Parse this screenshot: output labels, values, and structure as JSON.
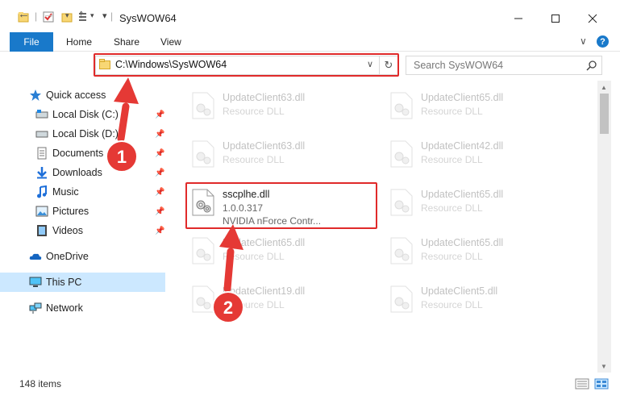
{
  "window": {
    "title": "SysWOW64",
    "minimize_icon": "minimize-icon",
    "maximize_icon": "maximize-icon",
    "close_icon": "close-icon"
  },
  "ribbon": {
    "tabs": [
      "File",
      "Home",
      "Share",
      "View"
    ],
    "help": "?"
  },
  "navigation": {
    "address": "C:\\Windows\\SysWOW64",
    "search_placeholder": "Search SysWOW64"
  },
  "sidebar": {
    "items": [
      {
        "label": "Quick access",
        "icon": "star-icon"
      },
      {
        "label": "Local Disk (C:)",
        "icon": "drive-icon",
        "pinned": true
      },
      {
        "label": "Local Disk (D:)",
        "icon": "drive-icon",
        "pinned": true
      },
      {
        "label": "Documents",
        "icon": "documents-icon",
        "pinned": true
      },
      {
        "label": "Downloads",
        "icon": "download-icon",
        "pinned": true
      },
      {
        "label": "Music",
        "icon": "music-icon",
        "pinned": true
      },
      {
        "label": "Pictures",
        "icon": "pictures-icon",
        "pinned": true
      },
      {
        "label": "Videos",
        "icon": "videos-icon",
        "pinned": true
      },
      {
        "label": "OneDrive",
        "icon": "onedrive-icon"
      },
      {
        "label": "This PC",
        "icon": "computer-icon",
        "selected": true
      },
      {
        "label": "Network",
        "icon": "network-icon"
      }
    ]
  },
  "files": [
    {
      "name": "UpdateClient63.dll",
      "type": "Resource DLL"
    },
    {
      "name": "UpdateClient65.dll",
      "type": "Resource DLL"
    },
    {
      "name": "UpdateClient63.dll",
      "type": "Resource DLL"
    },
    {
      "name": "UpdateClient42.dll",
      "type": "Resource DLL"
    },
    {
      "name": "sscplhe.dll",
      "version": "1.0.0.317",
      "description": "NVIDIA nForce Contr..."
    },
    {
      "name": "UpdateClient65.dll",
      "type": "Resource DLL"
    },
    {
      "name": "UpdateClient65.dll",
      "type": "Resource DLL"
    },
    {
      "name": "UpdateClient65.dll",
      "type": "Resource DLL"
    },
    {
      "name": "UpdateClient19.dll",
      "type": "Resource DLL"
    },
    {
      "name": "UpdateClient5.dll",
      "type": "Resource DLL"
    }
  ],
  "status": {
    "item_count": "148 items"
  },
  "annotations": {
    "step1": "1",
    "step2": "2",
    "highlight_color": "#e02a2a"
  }
}
